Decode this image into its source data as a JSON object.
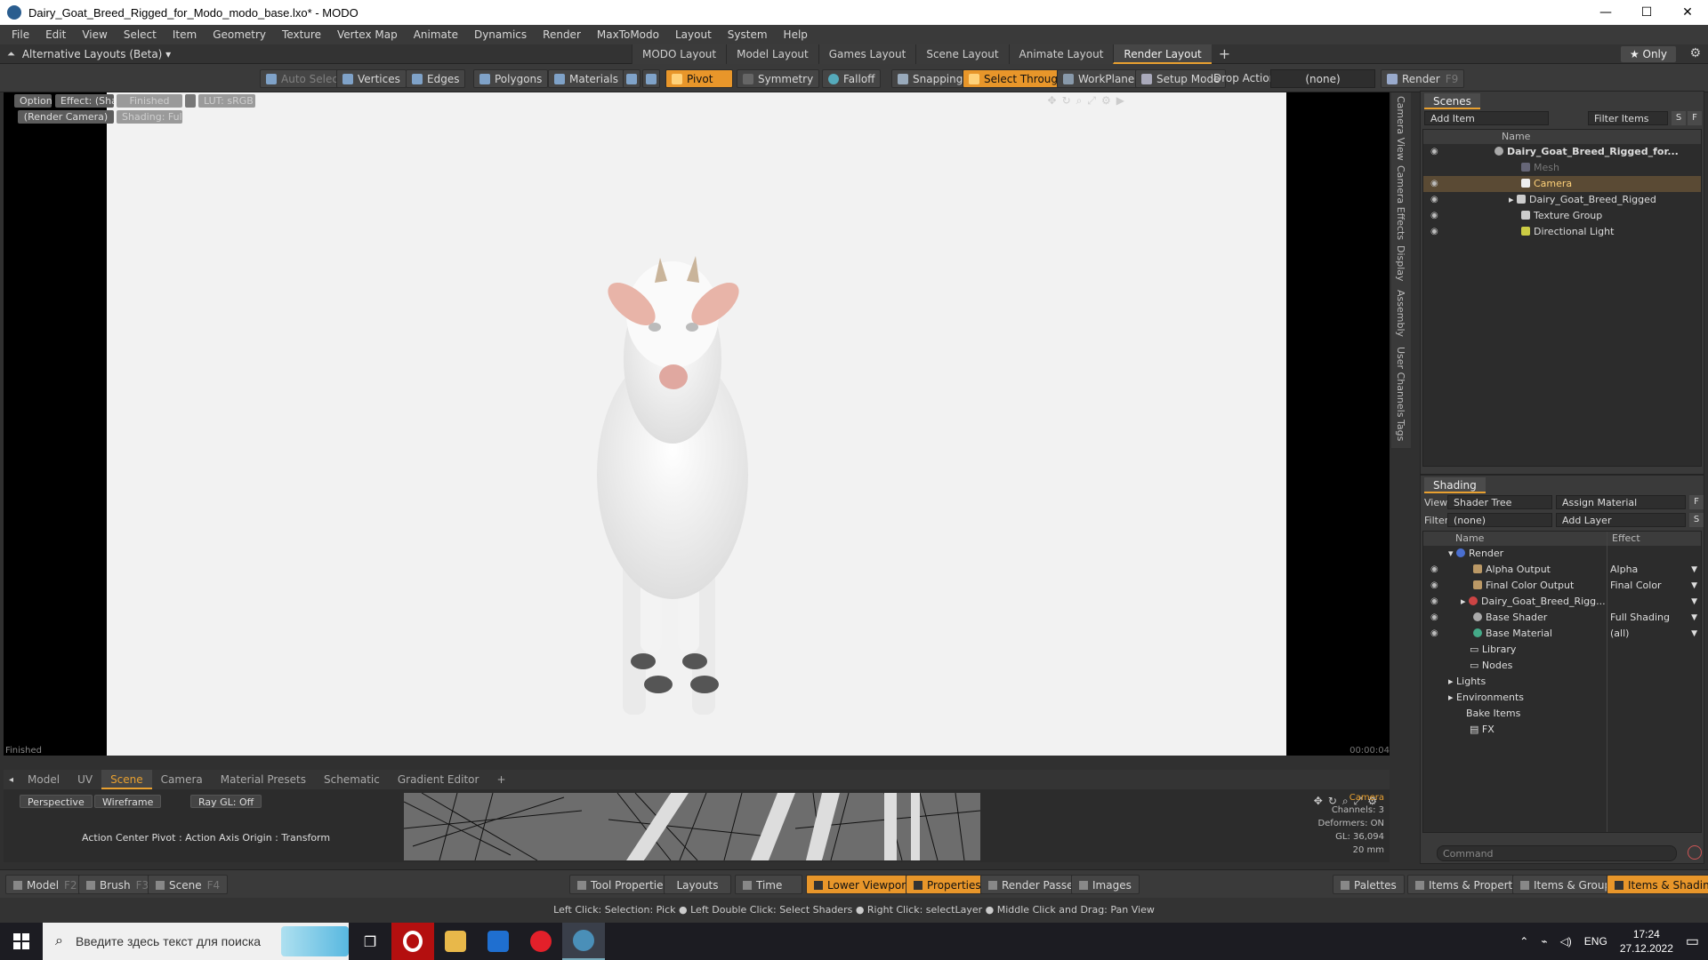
{
  "window": {
    "title": "Dairy_Goat_Breed_Rigged_for_Modo_modo_base.lxo* - MODO",
    "minimize": "—",
    "maximize": "☐",
    "close": "✕"
  },
  "menu": [
    "File",
    "Edit",
    "View",
    "Select",
    "Item",
    "Geometry",
    "Texture",
    "Vertex Map",
    "Animate",
    "Dynamics",
    "Render",
    "MaxToModo",
    "Layout",
    "System",
    "Help"
  ],
  "layoutbar": {
    "alternative": "Alternative Layouts (Beta) ▾",
    "tabs": [
      "MODO Layout",
      "Model Layout",
      "Games Layout",
      "Scene Layout",
      "Animate Layout",
      "Render Layout"
    ],
    "active_tab": "Render Layout",
    "add": "+",
    "only": "★ Only",
    "gear": "⚙"
  },
  "toolbar": {
    "auto_select": "Auto Select",
    "vertices": "Vertices",
    "edges": "Edges",
    "polygons": "Polygons",
    "materials": "Materials",
    "pivot": "Pivot",
    "symmetry": "Symmetry",
    "falloff": "Falloff",
    "snapping": "Snapping",
    "select_through": "Select Through",
    "workplane": "WorkPlane",
    "setup_mode": "Setup Mode",
    "drop_action_label": "Drop Action",
    "drop_action_value": "(none)",
    "render": "Render",
    "render_key": "F9"
  },
  "viewport": {
    "options": "Options",
    "effect": "Effect: (Shadi...",
    "finished_chip": "Finished",
    "lut": "LUT: sRGB",
    "render_camera": "(Render Camera)",
    "shading": "Shading: Full",
    "status": "Finished",
    "time": "00:00:04"
  },
  "sidetabs": [
    "Camera View",
    "Camera Effects",
    "Display",
    "Assembly",
    "User Channels",
    "Tags"
  ],
  "scenes": {
    "tab": "Scenes",
    "add_item": "Add Item",
    "filter_items": "Filter Items",
    "s_btn": "S",
    "f_btn": "F",
    "col_name": "Name",
    "items": [
      {
        "label": "Dairy_Goat_Breed_Rigged_for...",
        "bold": true
      },
      {
        "label": "Mesh",
        "dim": true
      },
      {
        "label": "Camera",
        "selected": true
      },
      {
        "label": "Dairy_Goat_Breed_Rigged"
      },
      {
        "label": "Texture Group"
      },
      {
        "label": "Directional Light"
      }
    ]
  },
  "shading": {
    "tab": "Shading",
    "view_label": "View",
    "view_value": "Shader Tree",
    "assign_material": "Assign Material",
    "f_btn": "F",
    "filter_label": "Filter",
    "filter_value": "(none)",
    "add_layer": "Add Layer",
    "s_btn": "S",
    "col_name": "Name",
    "col_effect": "Effect",
    "items": [
      {
        "label": "Render",
        "effect": ""
      },
      {
        "label": "Alpha Output",
        "effect": "Alpha"
      },
      {
        "label": "Final Color Output",
        "effect": "Final Color"
      },
      {
        "label": "Dairy_Goat_Breed_Rigg...",
        "effect": ""
      },
      {
        "label": "Base Shader",
        "effect": "Full Shading"
      },
      {
        "label": "Base Material",
        "effect": "(all)"
      },
      {
        "label": "Library",
        "effect": ""
      },
      {
        "label": "Nodes",
        "effect": ""
      },
      {
        "label": "Lights",
        "effect": ""
      },
      {
        "label": "Environments",
        "effect": ""
      },
      {
        "label": "Bake Items",
        "effect": ""
      },
      {
        "label": "FX",
        "effect": ""
      }
    ],
    "command_placeholder": "Command"
  },
  "bottomtabs": [
    "Model",
    "UV",
    "Scene",
    "Camera",
    "Material Presets",
    "Schematic",
    "Gradient Editor",
    "+"
  ],
  "bottomtabs_active": "Scene",
  "bottomvp": {
    "perspective": "Perspective",
    "wireframe": "Wireframe",
    "raygl": "Ray GL: Off",
    "action_center": "Action Center Pivot : Action Axis Origin : Transform",
    "info_label": "Camera",
    "channels": "Channels: 3",
    "deformers": "Deformers: ON",
    "gl": "GL: 36,094",
    "mm": "20 mm"
  },
  "bottombar": {
    "model": "Model",
    "model_key": "F2",
    "brush": "Brush",
    "brush_key": "F3",
    "scene": "Scene",
    "scene_key": "F4",
    "tool_properties": "Tool Properties",
    "layouts": "Layouts",
    "time": "Time",
    "lower_viewports": "Lower Viewports",
    "properties": "Properties",
    "render_passes": "Render Passes",
    "images": "Images",
    "palettes": "Palettes",
    "items_properties": "Items & Properties",
    "items_groups": "Items & Groups",
    "items_shading": "Items & Shading"
  },
  "statusbar": "Left Click: Selection: Pick ● Left Double Click: Select Shaders ● Right Click: selectLayer ● Middle Click and Drag: Pan View",
  "taskbar": {
    "search_placeholder": "Введите здесь текст для поиска",
    "lang": "ENG",
    "time": "17:24",
    "date": "27.12.2022"
  }
}
